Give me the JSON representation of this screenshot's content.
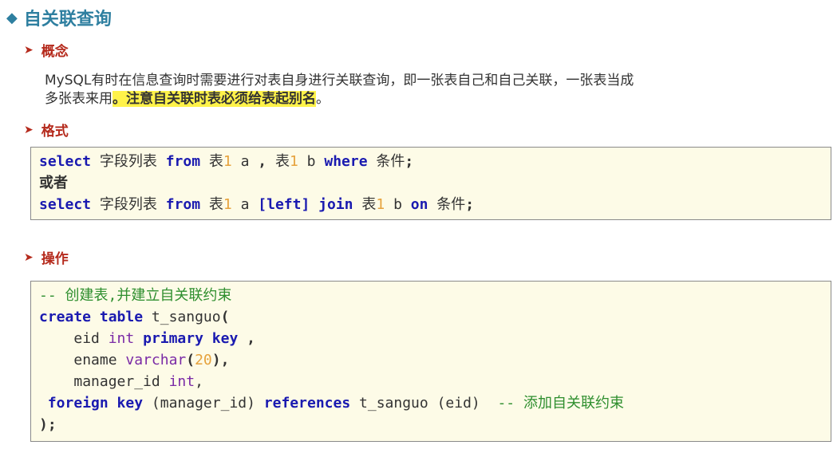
{
  "title": "自关联查询",
  "sections": {
    "concept": "概念",
    "format": "格式",
    "operation": "操作"
  },
  "concept_text": {
    "line1": "MySQL有时在信息查询时需要进行对表自身进行关联查询，即一张表自己和自己关联，一张表当成",
    "line2_plain": "多张表来用",
    "line2_highlight": "。注意自关联时表必须给表起别名",
    "line2_end": "。"
  },
  "format_code": {
    "select": "select",
    "field_list": "字段列表",
    "from": "from",
    "table": "表",
    "one": "1",
    "alias_a": "a",
    "comma": ",",
    "alias_b": "b",
    "where": "where",
    "condition": "条件",
    "semicolon": ";",
    "or": "或者",
    "left": "[left]",
    "join": "join",
    "on": "on"
  },
  "op_code": {
    "comment1": "-- 创建表,并建立自关联约束",
    "create_table": "create table",
    "table_name": "t_sanguo",
    "open_paren": "(",
    "eid": "eid",
    "int": "int",
    "primary_key": "primary key",
    "comma": ",",
    "ename": "ename",
    "varchar": "varchar",
    "twenty": "20",
    "manager_id": "manager_id",
    "foreign_key": "foreign key",
    "manager_id_paren": "(manager_id)",
    "references": "references",
    "eid_paren": "(eid)",
    "comment2": "-- 添加自关联约束",
    "close": ");"
  }
}
